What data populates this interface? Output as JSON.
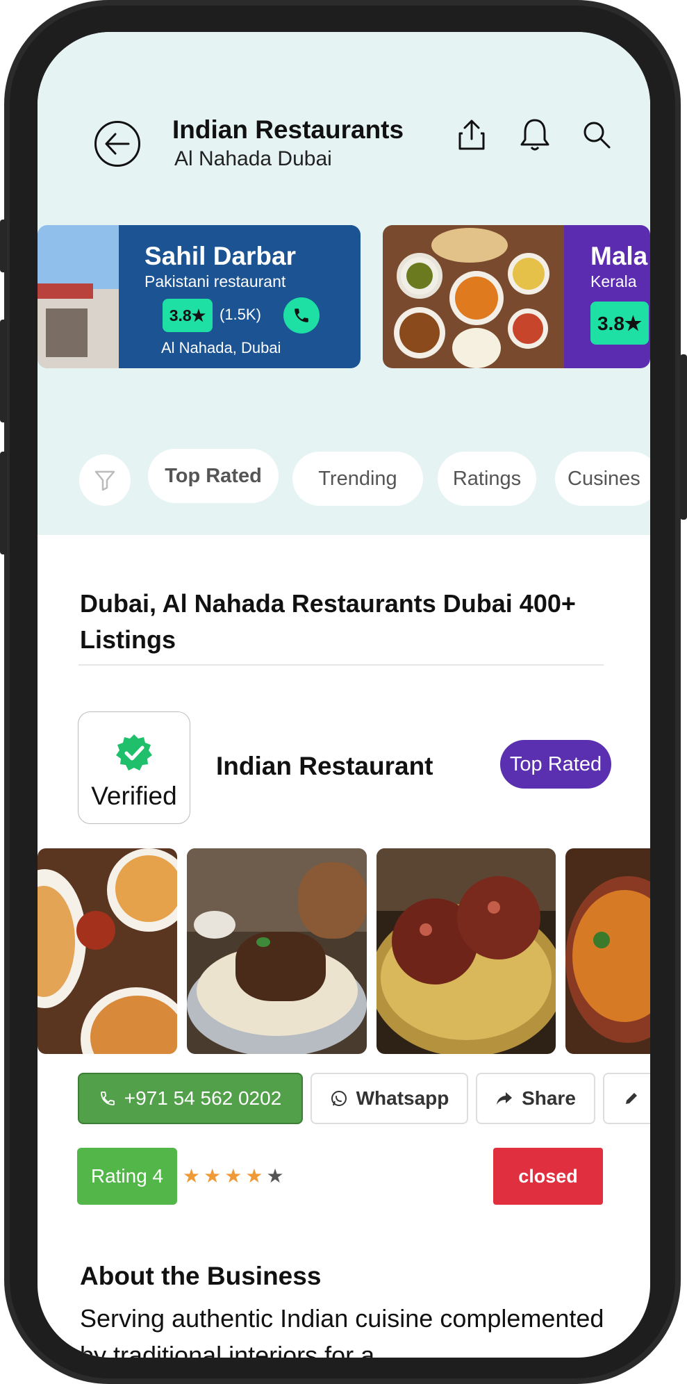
{
  "header": {
    "title": "Indian Restaurants",
    "subtitle": "Al Nahada Dubai",
    "back_icon": "arrow-left-icon",
    "share_icon": "share-upload-icon",
    "bell_icon": "bell-icon",
    "search_icon": "search-icon"
  },
  "carousel": {
    "cards": [
      {
        "name": "Sahil Darbar",
        "type": "Pakistani restaurant",
        "rating": "3.8★",
        "reviews": "(1.5K)",
        "location": "Al Nahada, Dubai",
        "color": "#1b5393"
      },
      {
        "name": "Mala",
        "type": "Kerala",
        "rating": "3.8★",
        "color": "#5b2bb0"
      }
    ]
  },
  "filters": {
    "icon": "filter-funnel-icon",
    "chips": [
      "Top Rated",
      "Trending",
      "Ratings",
      "Cusines"
    ]
  },
  "listing": {
    "heading": "Dubai, Al Nahada Restaurants Dubai 400+ Listings"
  },
  "business": {
    "verified_label": "Verified",
    "name": "Indian Restaurant",
    "badge": "Top Rated",
    "actions": {
      "phone": "+971 54 562 0202",
      "whatsapp": "Whatsapp",
      "share": "Share"
    },
    "rating_label": "Rating 4",
    "stars": 4,
    "stars_total": 5,
    "status": "closed",
    "about_heading": "About the Business",
    "about_text": "Serving authentic Indian cuisine complemented by traditional interiors for a"
  },
  "colors": {
    "header_bg": "#e6f3f3",
    "accent_green": "#1fe0a4",
    "phone_button": "#52a04a",
    "rating_green": "#52b649",
    "badge_purple": "#5a2fb0",
    "closed_red": "#e03040",
    "star_orange": "#ef9a36"
  }
}
